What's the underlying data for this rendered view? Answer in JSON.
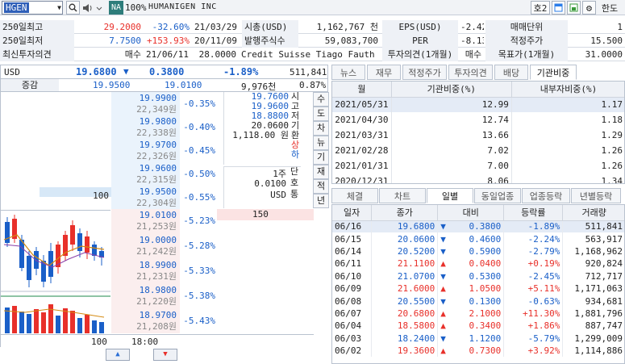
{
  "toolbar": {
    "symbol": "HGEN",
    "na_label": "NA",
    "zoom": "100%",
    "company": "HUMANIGEN INC",
    "ho_label": "호2",
    "limit_label": "한도",
    "query_label": "조회"
  },
  "header": {
    "row1": {
      "label": "250일최고",
      "price": "29.2000",
      "pct": "-32.60%",
      "date": "21/03/29",
      "label2": "시총(USD)",
      "value2": "1,162,767 천",
      "label3": "EPS(USD)",
      "value3": "-2.42",
      "label4": "매매단위",
      "value4": "1"
    },
    "row2": {
      "label": "250일최저",
      "price": "7.7500",
      "pct": "+153.93%",
      "date": "20/11/09",
      "label2": "발행주식수",
      "value2": "59,083,700",
      "label3": "PER",
      "value3": "-8.13",
      "label4": "적정주가",
      "value4": "15.500"
    },
    "row3": {
      "label": "최신투자의견",
      "opinion": "매수",
      "date": "21/06/11",
      "price": "28.0000",
      "firm": "Credit Suisse Tiago Fauth",
      "label3": "투자의견(1개월)",
      "value3": "매수",
      "label4": "목표가(1개월)",
      "value4": "31.0000"
    }
  },
  "quote": {
    "currency": "USD",
    "price": "19.6800",
    "change": "0.3800",
    "pct": "-1.89%",
    "volume": "511,841",
    "row2_label": "증감",
    "ask": "19.9500",
    "bid": "19.0100",
    "vol2": "9,976천",
    "pct2": "0.87%"
  },
  "orderbook": {
    "asks": [
      {
        "price": "19.9900",
        "krw": "22,349원",
        "pct": "-0.35%"
      },
      {
        "price": "19.9800",
        "krw": "22,338원",
        "pct": "-0.40%"
      },
      {
        "price": "19.9700",
        "krw": "22,326원",
        "pct": "-0.45%"
      },
      {
        "price": "19.9600",
        "krw": "22,315원",
        "pct": "-0.50%"
      },
      {
        "price": "19.9500",
        "krw": "22,304원",
        "pct": "-0.55%",
        "qty": "100"
      }
    ],
    "bids": [
      {
        "price": "19.0100",
        "krw": "21,253원",
        "pct": "-5.23%",
        "qty": "150"
      },
      {
        "price": "19.0000",
        "krw": "21,242원",
        "pct": "-5.28%"
      },
      {
        "price": "18.9900",
        "krw": "21,231원",
        "pct": "-5.33%"
      },
      {
        "price": "18.9800",
        "krw": "21,220원",
        "pct": "-5.38%"
      },
      {
        "price": "18.9700",
        "krw": "21,208원",
        "pct": "-5.43%"
      }
    ],
    "info": [
      "19.7600",
      "19.9600",
      "18.8800",
      "20.0600",
      "1,118.00 원"
    ],
    "info_labels": [
      "시",
      "고",
      "저",
      "기",
      "환",
      "상",
      "하"
    ],
    "unit1": "1주",
    "unit2": "0.0100",
    "unit3": "USD",
    "unit_labels": [
      "단",
      "호",
      "통"
    ],
    "footer_qty": "100",
    "footer_time": "18:00",
    "vtabs": [
      "수",
      "도",
      "차",
      "뉴",
      "기",
      "재",
      "적",
      "년"
    ]
  },
  "right_top": {
    "tabs": [
      "뉴스",
      "재무",
      "적정주가",
      "투자의견",
      "배당",
      "기관비중"
    ],
    "active_tab": 5,
    "columns": [
      "월",
      "기관비중(%)",
      "내부자비중(%)"
    ],
    "rows": [
      [
        "2021/05/31",
        "12.99",
        "1.17"
      ],
      [
        "2021/04/30",
        "12.74",
        "1.18"
      ],
      [
        "2021/03/31",
        "13.66",
        "1.29"
      ],
      [
        "2021/02/28",
        "7.02",
        "1.26"
      ],
      [
        "2021/01/31",
        "7.00",
        "1.26"
      ],
      [
        "2020/12/31",
        "8.06",
        "1.34"
      ]
    ]
  },
  "right_bottom": {
    "tabs": [
      "체결",
      "차트",
      "일별",
      "동일업종",
      "업종등락",
      "년별등락"
    ],
    "active_tab": 2,
    "columns": [
      "일자",
      "종가",
      "대비",
      "등락률",
      "거래량"
    ],
    "rows": [
      {
        "date": "06/16",
        "close": "19.6800",
        "dir": "down",
        "chg": "0.3800",
        "pct": "-1.89%",
        "vol": "511,841"
      },
      {
        "date": "06/15",
        "close": "20.0600",
        "dir": "down",
        "chg": "0.4600",
        "pct": "-2.24%",
        "vol": "563,917"
      },
      {
        "date": "06/14",
        "close": "20.5200",
        "dir": "down",
        "chg": "0.5900",
        "pct": "-2.79%",
        "vol": "1,168,962"
      },
      {
        "date": "06/11",
        "close": "21.1100",
        "dir": "up",
        "chg": "0.0400",
        "pct": "+0.19%",
        "vol": "920,824"
      },
      {
        "date": "06/10",
        "close": "21.0700",
        "dir": "down",
        "chg": "0.5300",
        "pct": "-2.45%",
        "vol": "712,717"
      },
      {
        "date": "06/09",
        "close": "21.6000",
        "dir": "up",
        "chg": "1.0500",
        "pct": "+5.11%",
        "vol": "1,171,063"
      },
      {
        "date": "06/08",
        "close": "20.5500",
        "dir": "down",
        "chg": "0.1300",
        "pct": "-0.63%",
        "vol": "934,681"
      },
      {
        "date": "06/07",
        "close": "20.6800",
        "dir": "up",
        "chg": "2.1000",
        "pct": "+11.30%",
        "vol": "1,881,796"
      },
      {
        "date": "06/04",
        "close": "18.5800",
        "dir": "up",
        "chg": "0.3400",
        "pct": "+1.86%",
        "vol": "887,747"
      },
      {
        "date": "06/03",
        "close": "18.2400",
        "dir": "down",
        "chg": "1.1200",
        "pct": "-5.79%",
        "vol": "1,299,009"
      },
      {
        "date": "06/02",
        "close": "19.3600",
        "dir": "up",
        "chg": "0.7300",
        "pct": "+3.92%",
        "vol": "1,114,886"
      }
    ]
  },
  "colors": {
    "up": "#e8302a",
    "down": "#1a5fc8",
    "accent": "#2b7de9"
  }
}
